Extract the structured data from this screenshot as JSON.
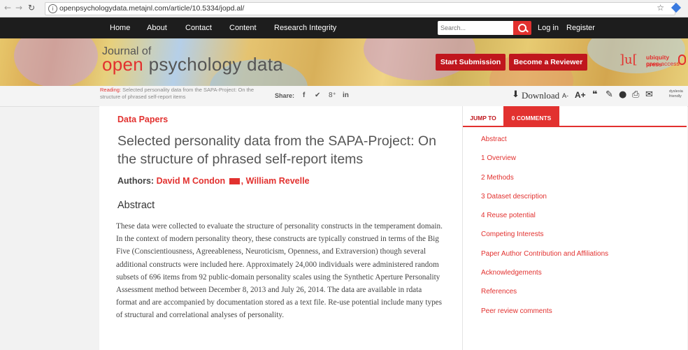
{
  "browser": {
    "url": "openpsychologydata.metajnl.com/article/10.5334/jopd.al/",
    "back_icon": "arrow-left",
    "forward_icon": "arrow-right",
    "reload_icon": "reload"
  },
  "nav": {
    "items": [
      "Home",
      "About",
      "Contact",
      "Content",
      "Research Integrity"
    ],
    "search_placeholder": "Search...",
    "login": "Log in",
    "register": "Register"
  },
  "banner": {
    "journal_of": "Journal of",
    "title_open": "open",
    "title_rest": " psychology data",
    "start_submission": "Start Submission",
    "become_reviewer": "Become a Reviewer",
    "publisher_line1": "ubiquity press",
    "publisher_line2": "open access"
  },
  "toolbar": {
    "reading_label": "Reading:",
    "reading_text": "Selected personality data from the SAPA-Project: On the structure of phrased self-report items",
    "share_label": "Share:",
    "download": "Download",
    "font_smaller": "A-",
    "font_larger": "A+",
    "dyslexia_line1": "dyslexia",
    "dyslexia_line2": "friendly"
  },
  "article": {
    "section": "Data Papers",
    "title": "Selected personality data from the SAPA-Project: On the structure of phrased self-report items",
    "authors_label": "Authors:",
    "author1": "David M Condon",
    "author2": "William Revelle",
    "abstract_heading": "Abstract",
    "abstract_text": "These data were collected to evaluate the structure of personality constructs in the temperament domain. In the context of modern personality theory, these constructs are typically construed in terms of the Big Five (Conscientiousness, Agreeableness, Neuroticism, Openness, and Extraversion) though several additional constructs were included here. Approximately 24,000 individuals were administered random subsets of 696 items from 92 public-domain personality scales using the Synthetic Aperture Personality Assessment method between December 8, 2013 and July 26, 2014. The data are available in rdata format and are accompanied by documentation stored as a text file. Re-use potential include many types of structural and correlational analyses of personality."
  },
  "sidebar": {
    "tab_jump": "JUMP TO",
    "tab_comments": "0 COMMENTS",
    "toc": [
      "Abstract",
      "1 Overview",
      "2 Methods",
      "3 Dataset description",
      "4 Reuse potential",
      "Competing Interests",
      "Paper Author Contribution and Affiliations",
      "Acknowledgements",
      "References",
      "Peer review comments"
    ]
  },
  "colors": {
    "accent": "#e2312f",
    "button_red": "#c0161d",
    "nav_bg": "#1d1d1d"
  }
}
